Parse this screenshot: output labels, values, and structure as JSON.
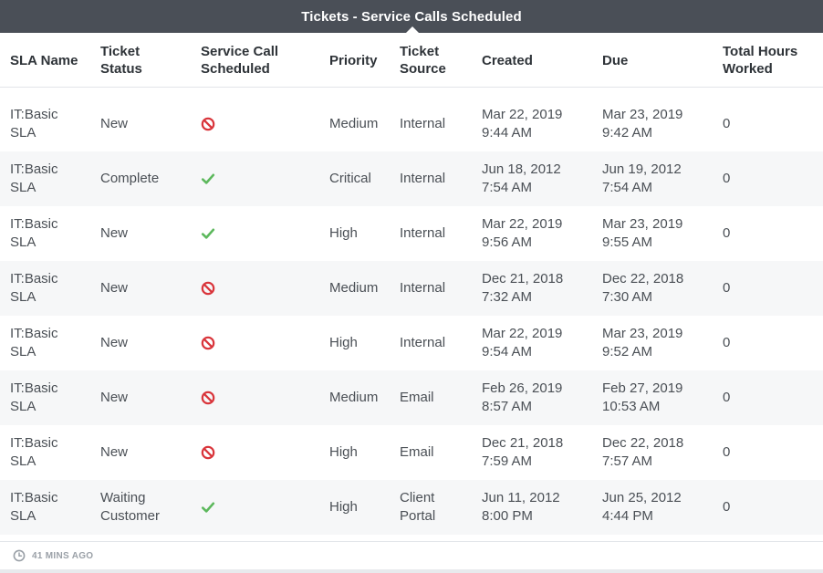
{
  "title": "Tickets - Service Calls Scheduled",
  "columns": {
    "sla": "SLA Name",
    "status": [
      "Ticket",
      "Status"
    ],
    "scheduled": [
      "Service Call",
      "Scheduled"
    ],
    "priority": "Priority",
    "source": [
      "Ticket",
      "Source"
    ],
    "created": "Created",
    "due": "Due",
    "hours": [
      "Total Hours",
      "Worked"
    ]
  },
  "rows": [
    {
      "sla": [
        "IT:Basic",
        "SLA"
      ],
      "status": [
        "New"
      ],
      "scheduled": "no",
      "priority": "Medium",
      "source": [
        "Internal"
      ],
      "created": [
        "Mar 22, 2019",
        "9:44 AM"
      ],
      "due": [
        "Mar 23, 2019",
        "9:42 AM"
      ],
      "hours": "0"
    },
    {
      "sla": [
        "IT:Basic",
        "SLA"
      ],
      "status": [
        "Complete"
      ],
      "scheduled": "yes",
      "priority": "Critical",
      "source": [
        "Internal"
      ],
      "created": [
        "Jun 18, 2012",
        "7:54 AM"
      ],
      "due": [
        "Jun 19, 2012",
        "7:54 AM"
      ],
      "hours": "0"
    },
    {
      "sla": [
        "IT:Basic",
        "SLA"
      ],
      "status": [
        "New"
      ],
      "scheduled": "yes",
      "priority": "High",
      "source": [
        "Internal"
      ],
      "created": [
        "Mar 22, 2019",
        "9:56 AM"
      ],
      "due": [
        "Mar 23, 2019",
        "9:55 AM"
      ],
      "hours": "0"
    },
    {
      "sla": [
        "IT:Basic",
        "SLA"
      ],
      "status": [
        "New"
      ],
      "scheduled": "no",
      "priority": "Medium",
      "source": [
        "Internal"
      ],
      "created": [
        "Dec 21, 2018",
        "7:32 AM"
      ],
      "due": [
        "Dec 22, 2018",
        "7:30 AM"
      ],
      "hours": "0"
    },
    {
      "sla": [
        "IT:Basic",
        "SLA"
      ],
      "status": [
        "New"
      ],
      "scheduled": "no",
      "priority": "High",
      "source": [
        "Internal"
      ],
      "created": [
        "Mar 22, 2019",
        "9:54 AM"
      ],
      "due": [
        "Mar 23, 2019",
        "9:52 AM"
      ],
      "hours": "0"
    },
    {
      "sla": [
        "IT:Basic",
        "SLA"
      ],
      "status": [
        "New"
      ],
      "scheduled": "no",
      "priority": "Medium",
      "source": [
        "Email"
      ],
      "created": [
        "Feb 26, 2019",
        "8:57 AM"
      ],
      "due": [
        "Feb 27, 2019",
        "10:53 AM"
      ],
      "hours": "0"
    },
    {
      "sla": [
        "IT:Basic",
        "SLA"
      ],
      "status": [
        "New"
      ],
      "scheduled": "no",
      "priority": "High",
      "source": [
        "Email"
      ],
      "created": [
        "Dec 21, 2018",
        "7:59 AM"
      ],
      "due": [
        "Dec 22, 2018",
        "7:57 AM"
      ],
      "hours": "0"
    },
    {
      "sla": [
        "IT:Basic",
        "SLA"
      ],
      "status": [
        "Waiting",
        "Customer"
      ],
      "scheduled": "yes",
      "priority": "High",
      "source": [
        "Client",
        "Portal"
      ],
      "created": [
        "Jun 11, 2012",
        "8:00 PM"
      ],
      "due": [
        "Jun 25, 2012",
        "4:44 PM"
      ],
      "hours": "0"
    }
  ],
  "footer": {
    "updated": "41 MINS AGO",
    "icon": "clock-icon"
  },
  "colors": {
    "title_bg": "#4a4f57",
    "no_icon": "#d9343a",
    "yes_icon": "#5cb85c",
    "alt_row": "#f6f7f8"
  }
}
